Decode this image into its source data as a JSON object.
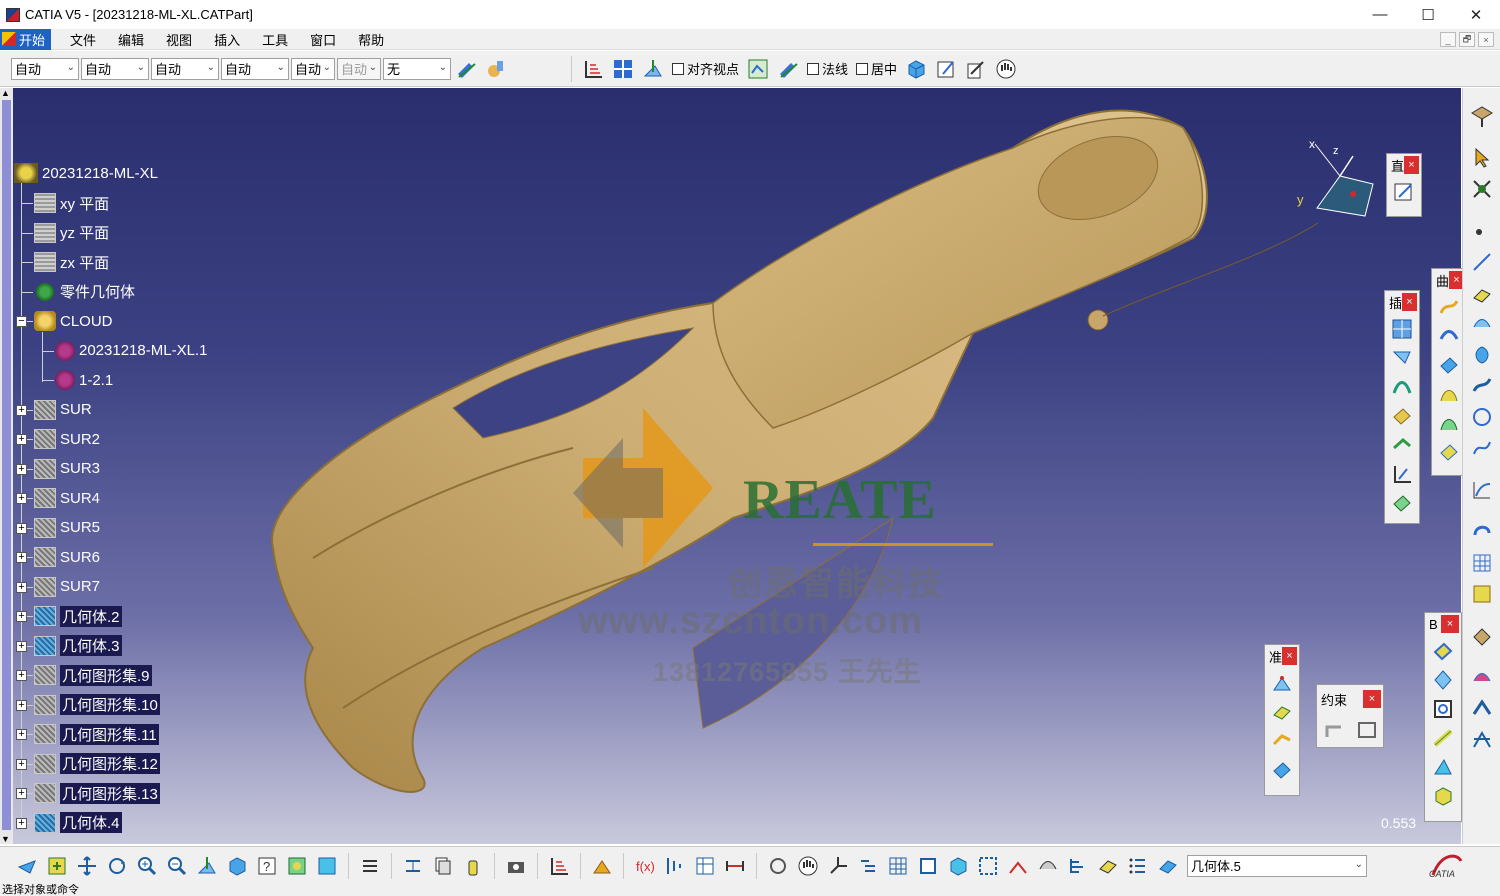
{
  "window": {
    "title": "CATIA V5 - [20231218-ML-XL.CATPart]",
    "buttons": [
      "—",
      "☐",
      "✕"
    ]
  },
  "menubar": {
    "start_label": "开始",
    "items": [
      "文件",
      "编辑",
      "视图",
      "插入",
      "工具",
      "窗口",
      "帮助"
    ],
    "mdi_buttons": [
      "_",
      "🗗",
      "×"
    ]
  },
  "toolbar1": {
    "combos": [
      {
        "value": "自动",
        "enabled": true
      },
      {
        "value": "自动",
        "enabled": true
      },
      {
        "value": "自动",
        "enabled": true
      },
      {
        "value": "自动",
        "enabled": true
      },
      {
        "value": "自动",
        "enabled": true
      },
      {
        "value": "自动",
        "enabled": false
      },
      {
        "value": "无",
        "enabled": true
      }
    ],
    "checkbox_align_viewpoint": "对齐视点",
    "checkbox_normal": "法线",
    "checkbox_center": "居中"
  },
  "tree": {
    "root": "20231218-ML-XL",
    "items": [
      {
        "label": "xy 平面",
        "icon": "plane-icon"
      },
      {
        "label": "yz 平面",
        "icon": "plane-icon"
      },
      {
        "label": "zx 平面",
        "icon": "plane-icon"
      },
      {
        "label": "零件几何体",
        "icon": "part-body-icon"
      },
      {
        "label": "CLOUD",
        "icon": "cloud-icon"
      },
      {
        "label": "20231218-ML-XL.1",
        "icon": "point-cloud-icon"
      },
      {
        "label": "1-2.1",
        "icon": "point-cloud-icon"
      },
      {
        "label": "SUR",
        "icon": "geo-set-icon"
      },
      {
        "label": "SUR2",
        "icon": "geo-set-icon"
      },
      {
        "label": "SUR3",
        "icon": "geo-set-icon"
      },
      {
        "label": "SUR4",
        "icon": "geo-set-icon"
      },
      {
        "label": "SUR5",
        "icon": "geo-set-icon"
      },
      {
        "label": "SUR6",
        "icon": "geo-set-icon"
      },
      {
        "label": "SUR7",
        "icon": "geo-set-icon"
      },
      {
        "label": "几何体.2",
        "icon": "body-icon"
      },
      {
        "label": "几何体.3",
        "icon": "body-icon"
      },
      {
        "label": "几何图形集.9",
        "icon": "geo-set-icon"
      },
      {
        "label": "几何图形集.10",
        "icon": "geo-set-icon"
      },
      {
        "label": "几何图形集.11",
        "icon": "geo-set-icon"
      },
      {
        "label": "几何图形集.12",
        "icon": "geo-set-icon"
      },
      {
        "label": "几何图形集.13",
        "icon": "geo-set-icon"
      },
      {
        "label": "几何体.4",
        "icon": "body-icon"
      }
    ]
  },
  "watermark": {
    "brand": "REATE",
    "company": "创恩智能科技",
    "url": "www.szcnton.com",
    "phone": "13812765855 王先生"
  },
  "compass": {
    "x_label": "x",
    "y_label": "y",
    "z_label": "z"
  },
  "panels": {
    "top_right_small": "直",
    "middle": "插",
    "right_curves": "曲",
    "bottom_right": "B",
    "bottom_left": "准",
    "constraint": "约束"
  },
  "zoom_readout": "0.553",
  "bottom": {
    "combo_value": "几何体.5"
  },
  "status": "选择对象或命令",
  "colors": {
    "viewport_top": "#2a2e6e",
    "viewport_bottom": "#c9c9dd",
    "part_color": "#c8a66a",
    "close_red": "#d9302f"
  }
}
